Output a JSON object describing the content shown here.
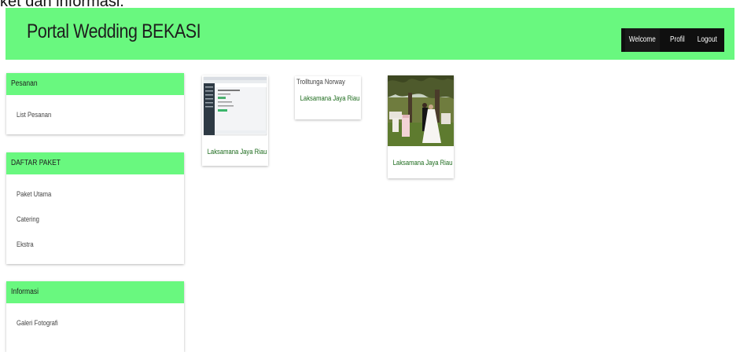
{
  "page_caption": "ket dan informasi.",
  "header": {
    "brand": "Portal Wedding BEKASI",
    "nav": [
      "Welcome",
      "Profil",
      "Logout"
    ]
  },
  "sidebar": {
    "panels": [
      {
        "title": "Pesanan",
        "links": [
          "List Pesanan"
        ]
      },
      {
        "title": "DAFTAR PAKET",
        "links": [
          "Paket Utama",
          "Catering",
          "Ekstra"
        ]
      },
      {
        "title": "Informasi",
        "links": [
          "Galeri Fotografi"
        ]
      }
    ]
  },
  "cards": [
    {
      "caption": "Laksamana Jaya Riau",
      "image": "admin-dashboard-screenshot"
    },
    {
      "alt_text": "Trolltunga Norway",
      "caption": "Laksamana Jaya Riau",
      "image": "broken-image"
    },
    {
      "caption": "Laksamana Jaya Riau",
      "image": "wedding-couple-photo"
    }
  ],
  "colors": {
    "header_green": "#69f87f",
    "nav_dark": "#0f0f0f",
    "caption_green": "#1d6b1d"
  }
}
